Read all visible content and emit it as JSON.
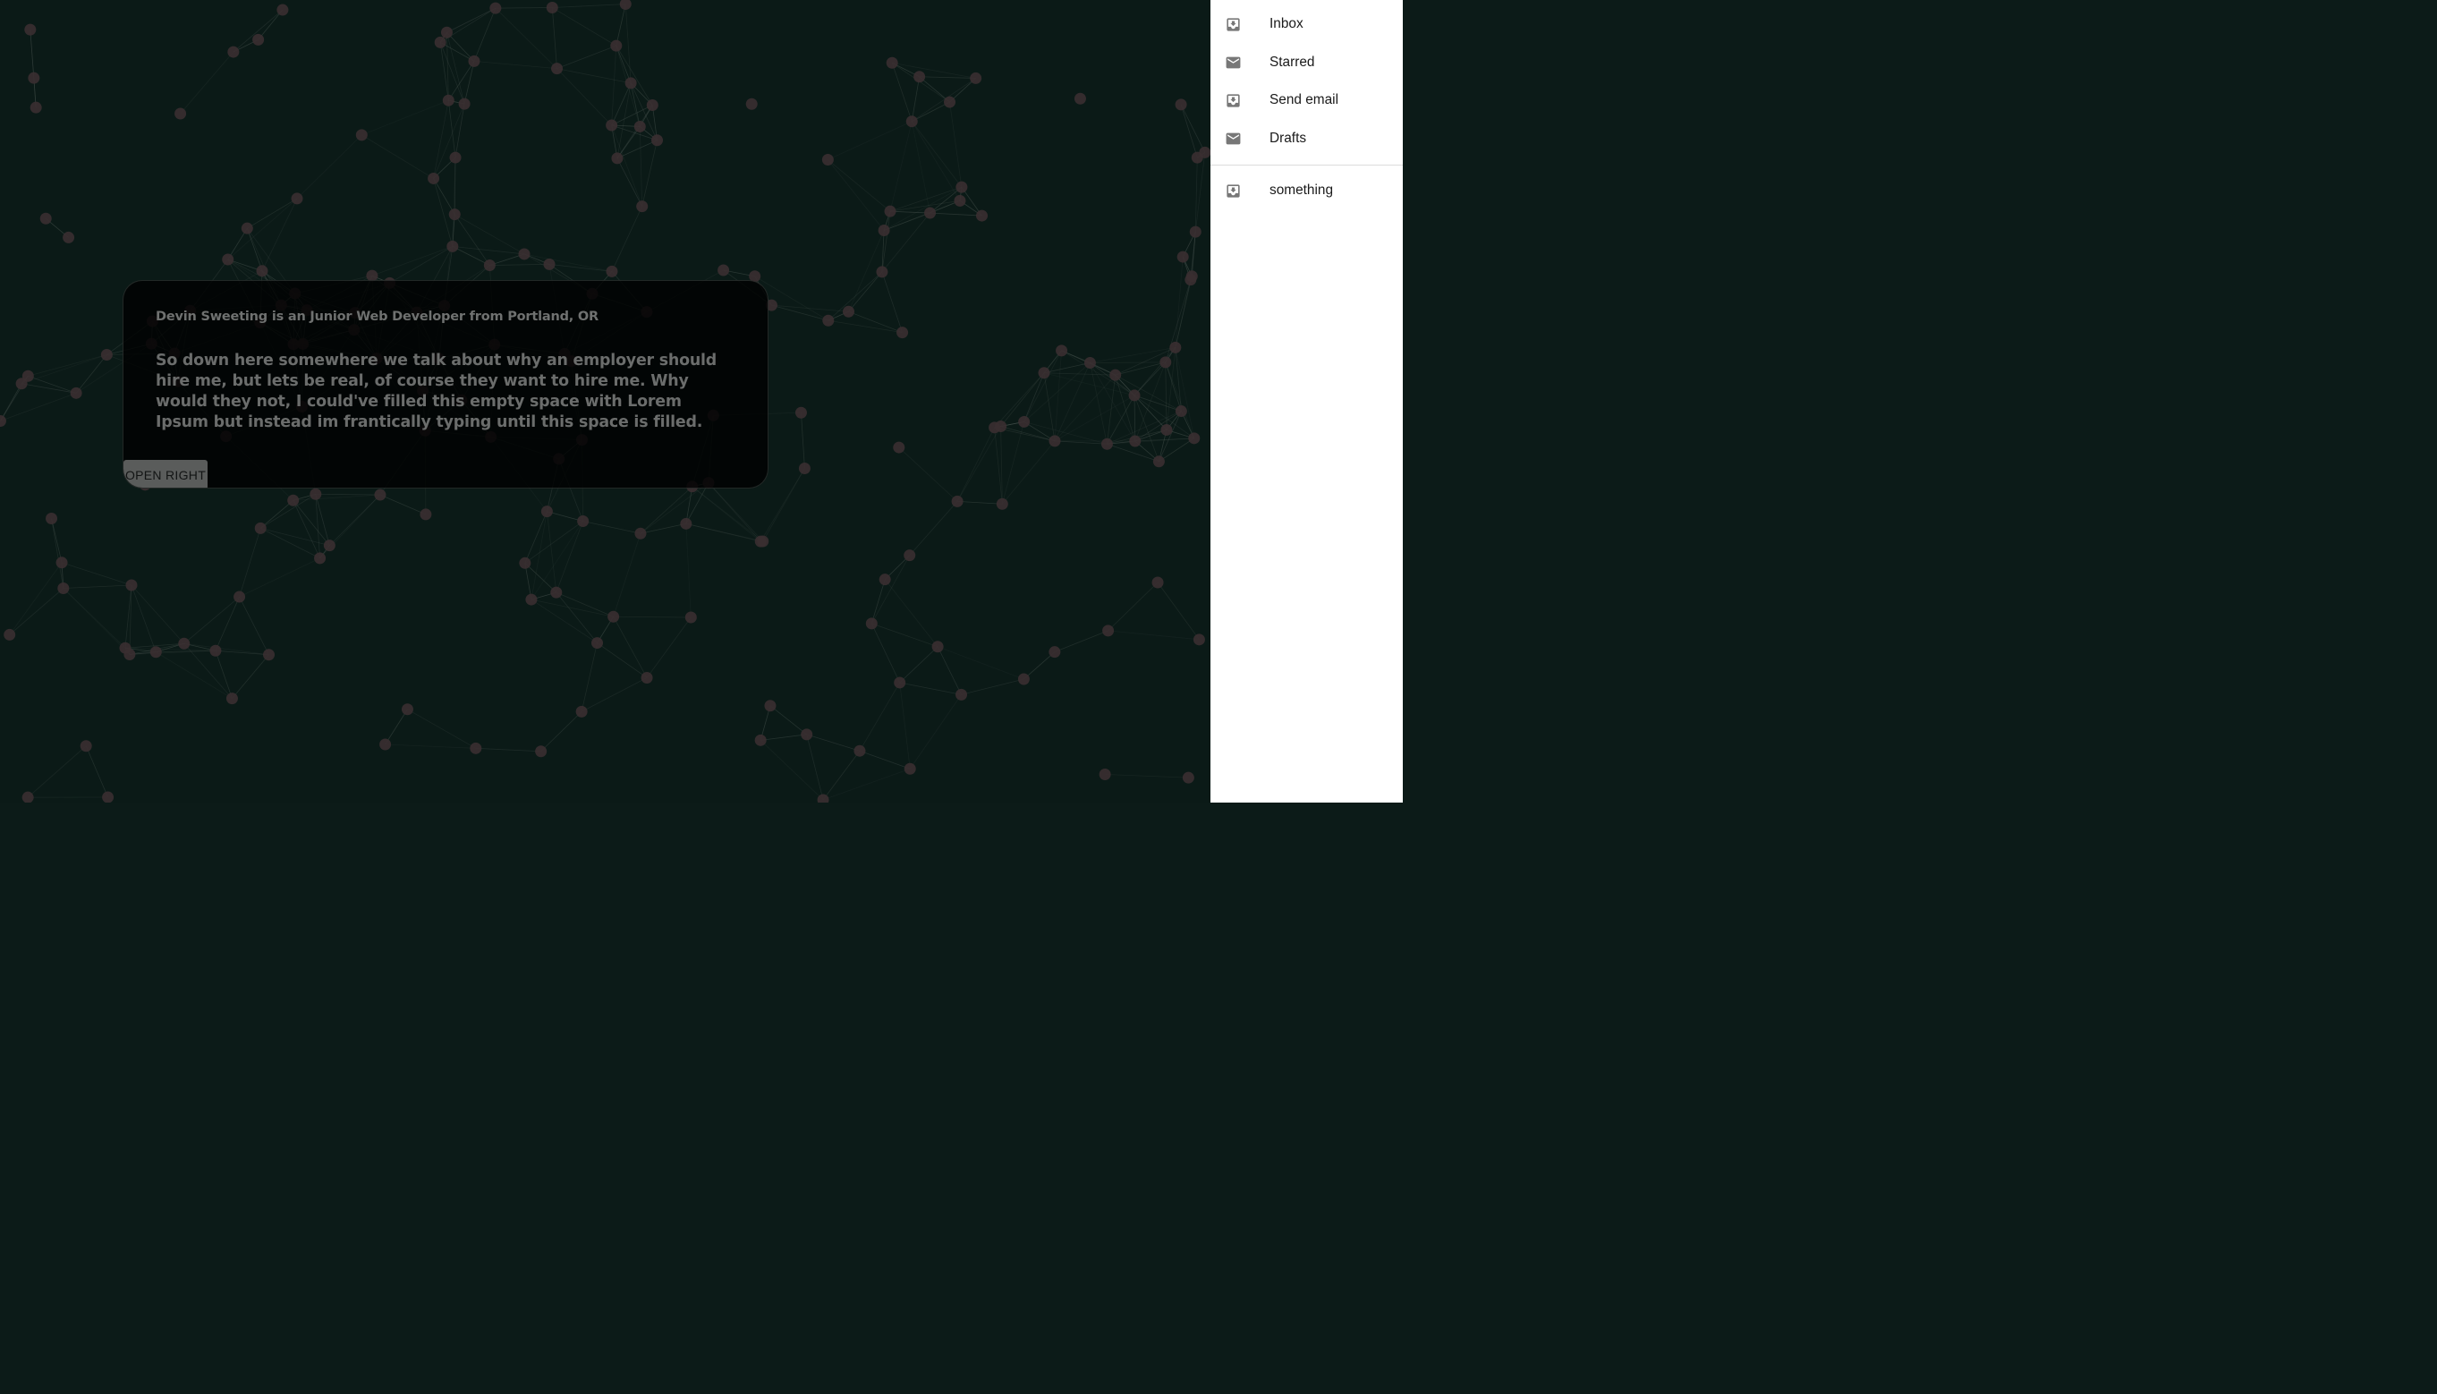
{
  "background": {
    "color": "#0b1a17",
    "node_color": "#3a2f31",
    "line_color": "#4c5752"
  },
  "card": {
    "title": "Devin Sweeting is an Junior Web Developer from Portland, OR",
    "body": "So down here somewhere we talk about why an employer should hire me, but lets be real, of course they want to hire me. Why would they not, I could've filled this empty space with Lorem Ipsum but instead im frantically typing until this space is filled.",
    "button_label": "OPEN RIGHT"
  },
  "drawer": {
    "primary_items": [
      {
        "label": "Inbox",
        "icon": "inbox-icon"
      },
      {
        "label": "Starred",
        "icon": "mail-icon"
      },
      {
        "label": "Send email",
        "icon": "inbox-icon"
      },
      {
        "label": "Drafts",
        "icon": "mail-icon"
      }
    ],
    "secondary_items": [
      {
        "label": "something",
        "icon": "inbox-icon"
      }
    ]
  }
}
